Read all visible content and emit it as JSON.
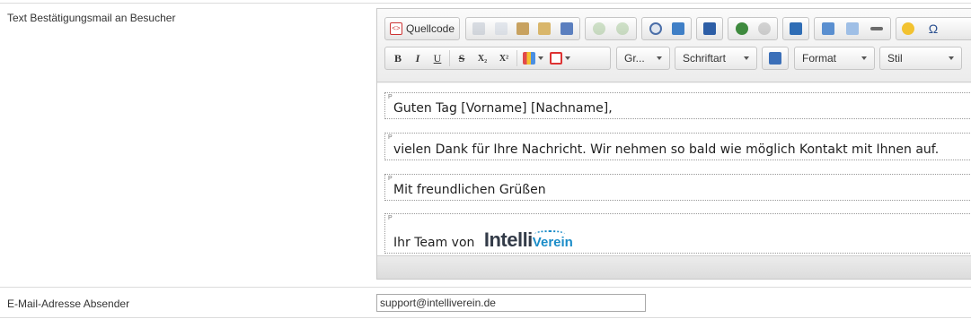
{
  "form": {
    "confirm_mail_label": "Text Bestätigungsmail an Besucher",
    "sender_label": "E-Mail-Adresse Absender",
    "sender_value": "support@intelliverein.de"
  },
  "toolbar": {
    "source_label": "Quellcode",
    "bold": "B",
    "italic": "I",
    "underline": "U",
    "strike": "S",
    "subscript": "X₂",
    "superscript": "X²",
    "size_combo": "Gr...",
    "font_combo": "Schriftart",
    "format_combo": "Format",
    "style_combo": "Stil",
    "omega": "Ω"
  },
  "editor": {
    "paragraph_tag": "P",
    "paragraphs": [
      "Guten Tag [Vorname] [Nachname],",
      "vielen Dank für Ihre Nachricht. Wir nehmen so bald wie möglich Kontakt mit Ihnen auf.",
      "Mit freundlichen Grüßen",
      "Ihr Team von"
    ],
    "logo_main": "Intelli",
    "logo_sub": "Verein"
  },
  "colors": {
    "logo_dark": "#333b48",
    "logo_blue": "#1a8cc8"
  }
}
